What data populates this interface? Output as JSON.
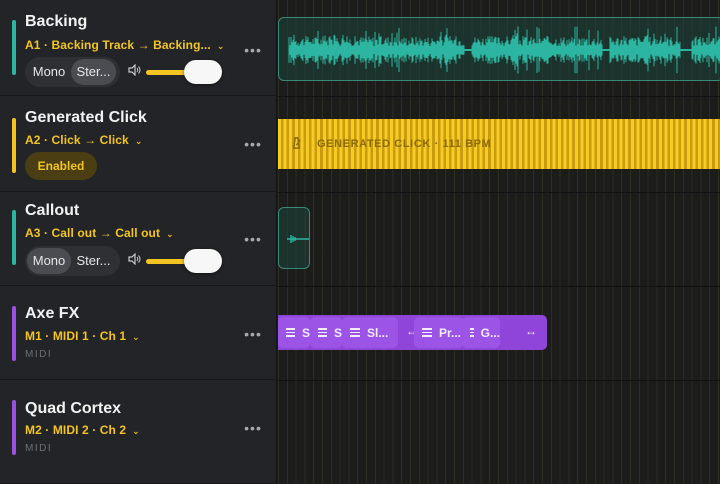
{
  "colors": {
    "audio_accent": "#2cb5a0",
    "click_accent": "#f3c522",
    "midi_accent": "#9b50e0"
  },
  "tracks": [
    {
      "title": "Backing",
      "route": "A1 · Backing Track → Backing...",
      "mono_label": "Mono",
      "stereo_label": "Ster...",
      "selected": "stereo",
      "volume": 1.0
    },
    {
      "title": "Generated Click",
      "route": "A2 · Click → Click",
      "enabled_label": "Enabled"
    },
    {
      "title": "Callout",
      "route": "A3 · Call out → Call out",
      "mono_label": "Mono",
      "stereo_label": "Ster...",
      "selected": "mono",
      "volume": 1.0
    },
    {
      "title": "Axe FX",
      "route": "M1 · MIDI 1 · Ch 1",
      "type_label": "MIDI"
    },
    {
      "title": "Quad Cortex",
      "route": "M2 · MIDI 2 · Ch 2",
      "type_label": "MIDI"
    }
  ],
  "icons": {
    "more": "more-horizontal-icon",
    "volume": "speaker-icon",
    "chevron": "chevron-down-icon",
    "metronome": "metronome-icon",
    "drag": "drag-handle-icon",
    "resize": "resize-horizontal-icon"
  },
  "timeline": {
    "click_region_label": "GENERATED CLICK · 111 BPM",
    "midi_events": [
      "S",
      "S",
      "Sl...",
      "Pr...",
      "G..."
    ]
  }
}
